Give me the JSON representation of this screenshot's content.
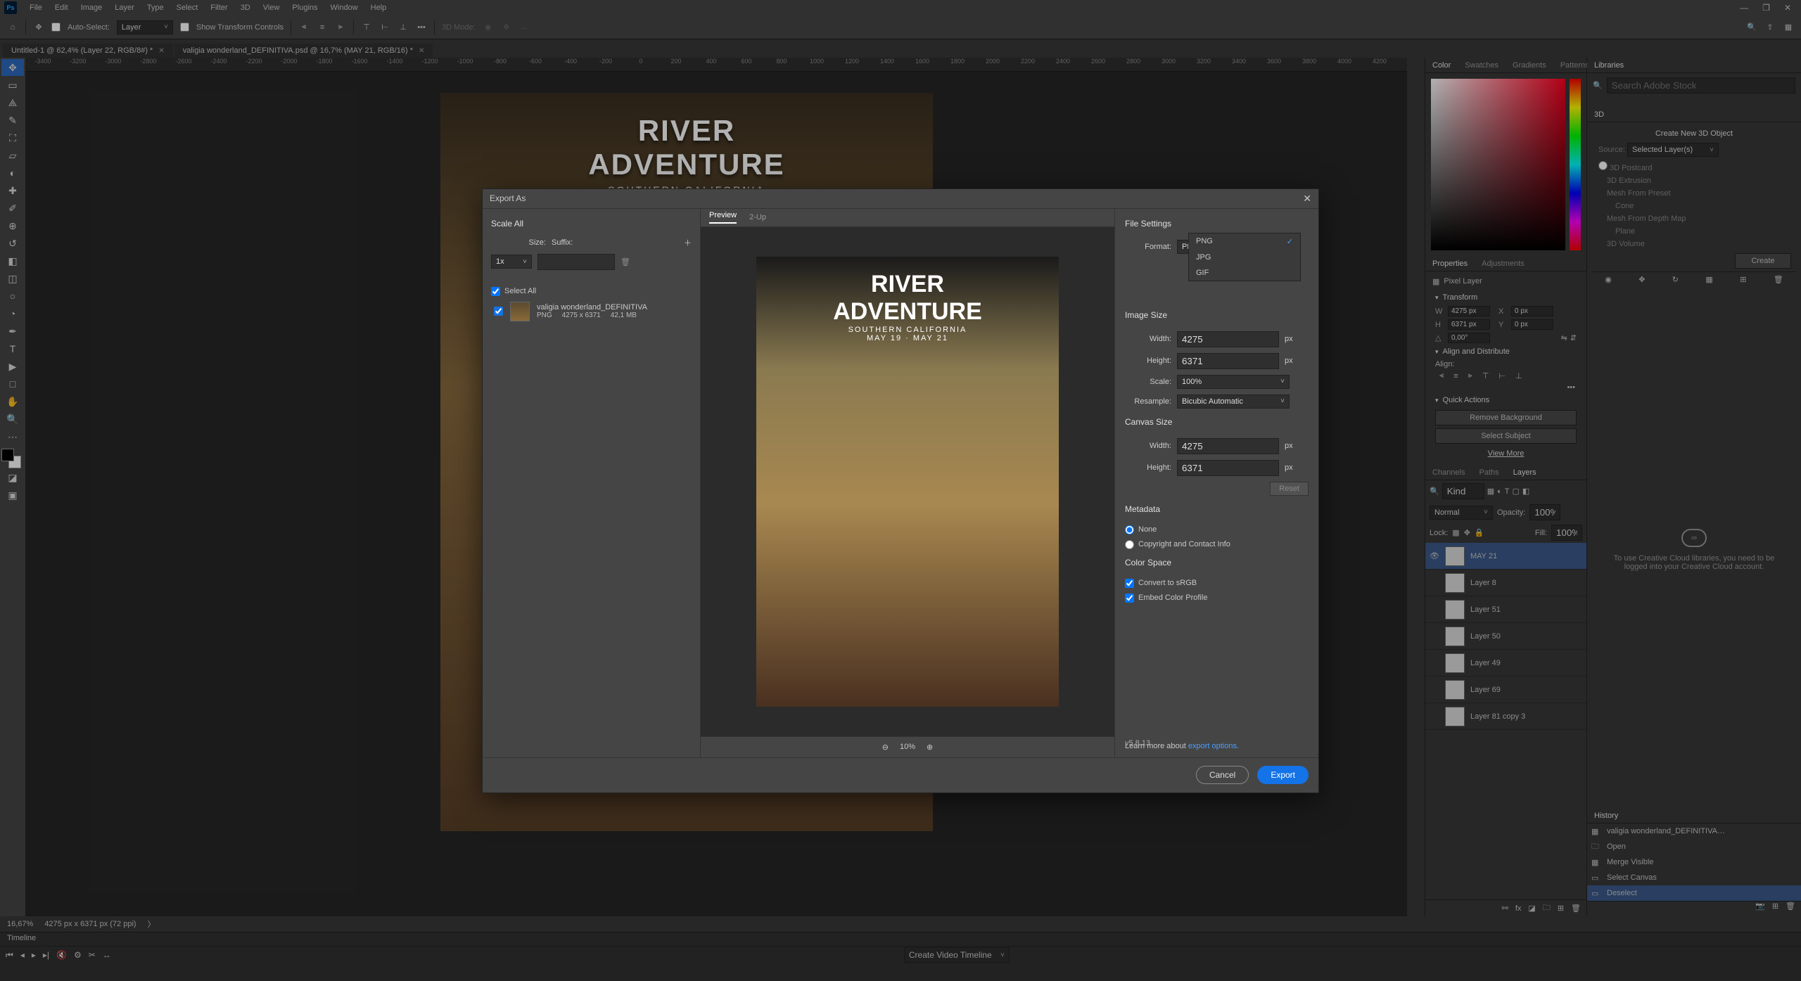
{
  "menu": [
    "File",
    "Edit",
    "Image",
    "Layer",
    "Type",
    "Select",
    "Filter",
    "3D",
    "View",
    "Plugins",
    "Window",
    "Help"
  ],
  "optbar": {
    "auto_select": "Auto-Select:",
    "auto_target": "Layer",
    "show_transform": "Show Transform Controls",
    "mode3d": "3D Mode:"
  },
  "tabs": [
    "Untitled-1 @ 62,4% (Layer 22, RGB/8#) *",
    "valigia wonderland_DEFINITIVA.psd @ 16,7% (MAY 21, RGB/16) *"
  ],
  "artwork": {
    "title_line1": "RIVER",
    "title_line2": "ADVENTURE",
    "subtitle": "SOUTHERN CALIFORNIA",
    "dates": "MAY 19 · MAY 21"
  },
  "status": {
    "zoom": "16,67%",
    "dims": "4275 px x 6371 px (72 ppi)"
  },
  "timeline": {
    "title": "Timeline",
    "btn": "Create Video Timeline"
  },
  "panels": {
    "color_tabs": [
      "Color",
      "Swatches",
      "Gradients",
      "Patterns"
    ],
    "libraries_tab": "Libraries",
    "libraries_msg": "To use Creative Cloud libraries, you need to be logged into your Creative Cloud account.",
    "search_ph": "Search Adobe Stock",
    "props_tabs": [
      "Properties",
      "Adjustments"
    ],
    "props_kind": "Pixel Layer",
    "transform": "Transform",
    "w": "4275 px",
    "h": "6371 px",
    "x": "0 px",
    "y": "0 px",
    "angle": "0,00°",
    "align_title": "Align and Distribute",
    "align_label": "Align:",
    "qa_title": "Quick Actions",
    "qa_remove_bg": "Remove Background",
    "qa_select_subject": "Select Subject",
    "qa_view_more": "View More",
    "layer_tabs": [
      "Channels",
      "Paths",
      "Layers"
    ],
    "blend": "Normal",
    "opacity_l": "Opacity:",
    "opacity": "100%",
    "lock": "Lock:",
    "fill_l": "Fill:",
    "fill": "100%",
    "layer_search_ph": "Kind",
    "layers": [
      "MAY 21",
      "Layer 8",
      "Layer 51",
      "Layer 50",
      "Layer 49",
      "Layer 69",
      "Layer 81 copy 3"
    ],
    "history_tab": "History",
    "history_doc": "valigia wonderland_DEFINITIVA…",
    "history": [
      "Open",
      "Merge Visible",
      "Select Canvas",
      "Deselect"
    ],
    "p3d_tab": "3D",
    "p3d_create": "Create New 3D Object",
    "p3d_source": "Source:",
    "p3d_source_v": "Selected Layer(s)",
    "p3d_opts": [
      "3D Postcard",
      "3D Extrusion",
      "Mesh From Preset",
      "Cone",
      "Mesh From Depth Map",
      "Plane",
      "3D Volume"
    ],
    "p3d_btn": "Create"
  },
  "export": {
    "title": "Export As",
    "scale_all": "Scale All",
    "size_l": "Size:",
    "suffix_l": "Suffix:",
    "size_v": "1x",
    "select_all": "Select All",
    "asset_name": "valigia wonderland_DEFINITIVA",
    "asset_fmt": "PNG",
    "asset_dims": "4275 x 6371",
    "asset_size": "42,1 MB",
    "tab_preview": "Preview",
    "tab_2up": "2-Up",
    "zoom": "10%",
    "fs_title": "File Settings",
    "format_l": "Format:",
    "format_v": "PNG",
    "format_opts": [
      "PNG",
      "JPG",
      "GIF"
    ],
    "is_title": "Image Size",
    "width_l": "Width:",
    "width_v": "4275",
    "height_l": "Height:",
    "height_v": "6371",
    "scale_l": "Scale:",
    "scale_v": "100%",
    "resample_l": "Resample:",
    "resample_v": "Bicubic Automatic",
    "cs_title": "Canvas Size",
    "cw": "4275",
    "ch": "6371",
    "reset": "Reset",
    "meta_title": "Metadata",
    "meta_none": "None",
    "meta_cc": "Copyright and Contact Info",
    "colspace_title": "Color Space",
    "srgb": "Convert to sRGB",
    "embed": "Embed Color Profile",
    "learn_pre": "Learn more about ",
    "learn_link": "export options.",
    "version": "v5.8.13",
    "cancel": "Cancel",
    "export_btn": "Export",
    "px": "px"
  }
}
